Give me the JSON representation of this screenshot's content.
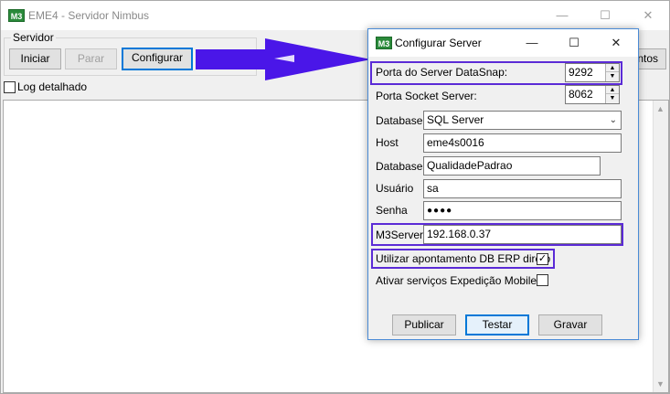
{
  "main_window": {
    "title": "EME4 - Servidor Nimbus",
    "app_icon_text": "M3",
    "group_label": "Servidor",
    "buttons": {
      "iniciar": "Iniciar",
      "parar": "Parar",
      "configurar": "Configurar",
      "partial_right": "ntos"
    },
    "log_checkbox_label": "Log detalhado",
    "log_checked": false
  },
  "dialog": {
    "title": "Configurar Server",
    "app_icon_text": "M3",
    "fields": {
      "porta_datasnap": {
        "label": "Porta do Server DataSnap:",
        "value": "9292"
      },
      "porta_socket": {
        "label": "Porta Socket Server:",
        "value": "8062"
      },
      "database_type": {
        "label": "Database",
        "value": "SQL Server"
      },
      "host": {
        "label": "Host",
        "value": "eme4s0016"
      },
      "database_name": {
        "label": "Database",
        "value": "QualidadePadrao"
      },
      "usuario": {
        "label": "Usuário",
        "value": "sa"
      },
      "senha": {
        "label": "Senha",
        "value": "●●●●"
      },
      "m3server": {
        "label": "M3Server",
        "value": "192.168.0.37"
      }
    },
    "checkboxes": {
      "apontamento": {
        "label": "Utilizar apontamento DB ERP direto",
        "checked": true
      },
      "expedicao": {
        "label": "Ativar serviços Expedição Mobile",
        "checked": false
      }
    },
    "buttons": {
      "publicar": "Publicar",
      "testar": "Testar",
      "gravar": "Gravar"
    }
  },
  "colors": {
    "highlight": "#5b2bd6",
    "arrow": "#4a16e8",
    "focus": "#0078d7"
  }
}
